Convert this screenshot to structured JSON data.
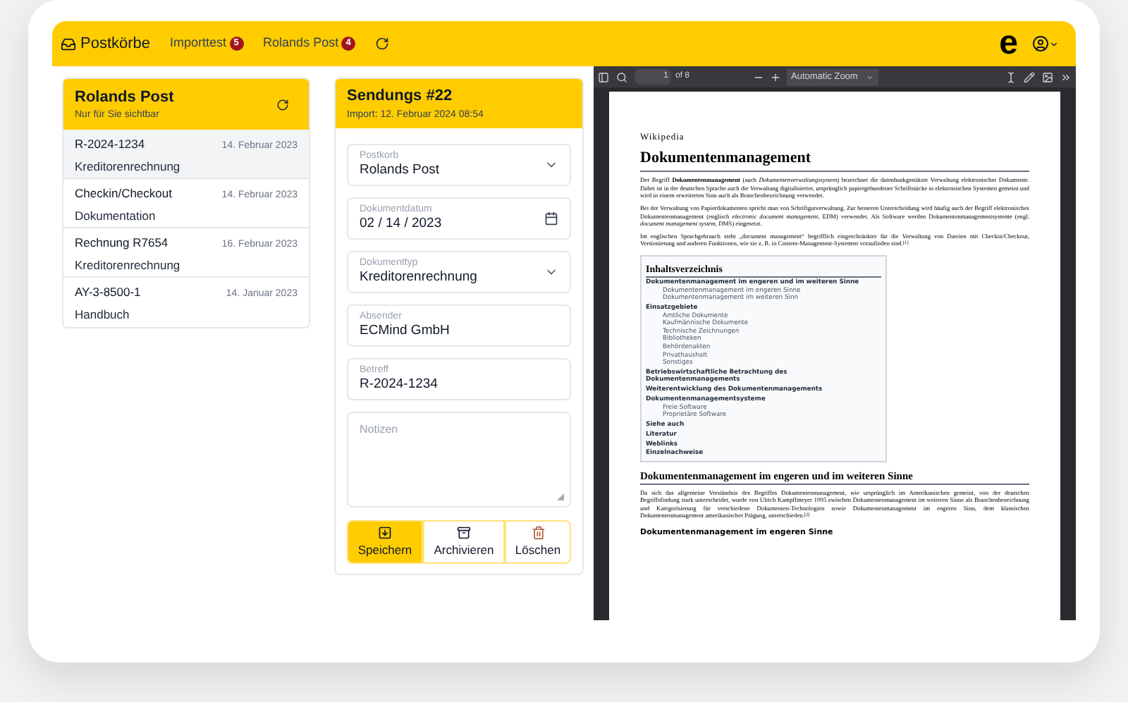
{
  "header": {
    "title": "Postkörbe",
    "tabs": [
      {
        "label": "Importtest",
        "badge": "5"
      },
      {
        "label": "Rolands Post",
        "badge": "4"
      }
    ],
    "logo": "e"
  },
  "inbox": {
    "title": "Rolands Post",
    "subtitle": "Nur für Sie sichtbar",
    "items": [
      {
        "title": "R-2024-1234",
        "date": "14. Februar 2023",
        "type": "Kreditorenrechnung",
        "selected": true
      },
      {
        "title": "Checkin/Checkout",
        "date": "14. Februar 2023",
        "type": "Dokumentation",
        "selected": false
      },
      {
        "title": "Rechnung R7654",
        "date": "16. Februar 2023",
        "type": "Kreditorenrechnung",
        "selected": false
      },
      {
        "title": "AY-3-8500-1",
        "date": "14. Januar 2023",
        "type": "Handbuch",
        "selected": false
      }
    ]
  },
  "form": {
    "title": "Sendungs #22",
    "subtitle": "Import: 12. Februar 2024 08:54",
    "fields": [
      {
        "kind": "select",
        "label": "Postkorb",
        "value": "Rolands Post"
      },
      {
        "kind": "date",
        "label": "Dokumentdatum",
        "value": "02 / 14 / 2023"
      },
      {
        "kind": "select",
        "label": "Dokumenttyp",
        "value": "Kreditorenrechnung"
      },
      {
        "kind": "text",
        "label": "Absender",
        "value": "ECMind GmbH"
      },
      {
        "kind": "text",
        "label": "Betreff",
        "value": "R-2024-1234"
      },
      {
        "kind": "textarea",
        "placeholder": "Notizen"
      }
    ],
    "buttons": [
      {
        "kind": "save",
        "label": "Speichern"
      },
      {
        "kind": "archive",
        "label": "Archivieren"
      },
      {
        "kind": "delete",
        "label": "Löschen"
      }
    ]
  },
  "pdf_viewer": {
    "page": "1",
    "page_count": "of 8",
    "zoom": "Automatic Zoom",
    "document": {
      "site": "Wikipedia",
      "title": "Dokumentenmanagement",
      "paragraphs": [
        "Der Begriff **Dokumentenmanagement** (auch *Dokumentenverwaltungssystem*) bezeichnet die datenbankgestützte Verwaltung elektronischer Dokumente. Dabei ist in der deutschen Sprache auch die Verwaltung digitalisierter, ursprünglich papiergebundener Schriftstücke in elektronischen Systemen gemeint und wird in einem erweiterten Sinn auch als Branchenbezeichnung verwendet.",
        "Bei der Verwaltung von Papierdokumenten spricht man von Schriftgutverwaltung. Zur besseren Unterscheidung wird häufig auch der Begriff elektronisches Dokumentenmanagement (englisch *electronic document management*, EDM) verwendet. Als Software werden Dokumentenmanagementsysteme (engl. *document management system*, DMS) eingesetzt.",
        "Im englischen Sprachgebrauch steht „document management“ begrifflich eingeschränkter für die Verwaltung von Dateien mit Checkin/Checkout, Versionierung und anderen Funktionen, wie sie z. B. in Content-Management-Systemen vorzufinden sind.$^{[1]}$"
      ],
      "toc_title": "Inhaltsverzeichnis",
      "toc": [
        {
          "label": "Dokumentenmanagement im engeren und im weiteren Sinne",
          "children": [
            {
              "label": "Dokumentenmanagement im engeren Sinne"
            },
            {
              "label": "Dokumentenmanagement im weiteren Sinn"
            }
          ]
        },
        {
          "label": "Einsatzgebiete",
          "children": [
            {
              "label": "Amtliche Dokumente"
            },
            {
              "label": "Kaufmännische Dokumente"
            },
            {
              "label": "Technische Zeichnungen"
            },
            {
              "label": "Bibliotheken"
            },
            {
              "label": "Behördenakten"
            },
            {
              "label": "Privathaushalt"
            },
            {
              "label": "Sonstiges"
            }
          ]
        },
        {
          "label": "Betriebswirtschaftliche Betrachtung des Dokumentenmanagements"
        },
        {
          "label": "Weiterentwicklung des Dokumentenmanagements"
        },
        {
          "label": "Dokumentenmanagementsysteme",
          "children": [
            {
              "label": "Freie Software"
            },
            {
              "label": "Proprietäre Software"
            }
          ]
        },
        {
          "label": "Siehe auch"
        },
        {
          "label": "Literatur"
        },
        {
          "label": "Weblinks"
        },
        {
          "label": "Einzelnachweise"
        }
      ],
      "section_title": "Dokumentenmanagement im engeren und im weiteren Sinne",
      "section_text": "Da sich das allgemeine Verständnis des Begriffes Dokumentenmanagement, wie ursprünglich im Amerikanischen gemeint, von der deutschen Begriffsfindung stark unterscheidet, wurde von Ulrich Kampffmeyer 1995 zwischen Dokumentenmanagement im weiteren Sinne als Branchenbezeichnung und Kategorisierung für verschiedene Dokumenten-Technologien sowie Dokumentenmanagement im engeren Sinn, dem klassischen Dokumentenmanagement amerikanischer Prägung, unterschieden.$^{[2]}$",
      "subsection_title": "Dokumentenmanagement im engeren Sinne"
    }
  }
}
